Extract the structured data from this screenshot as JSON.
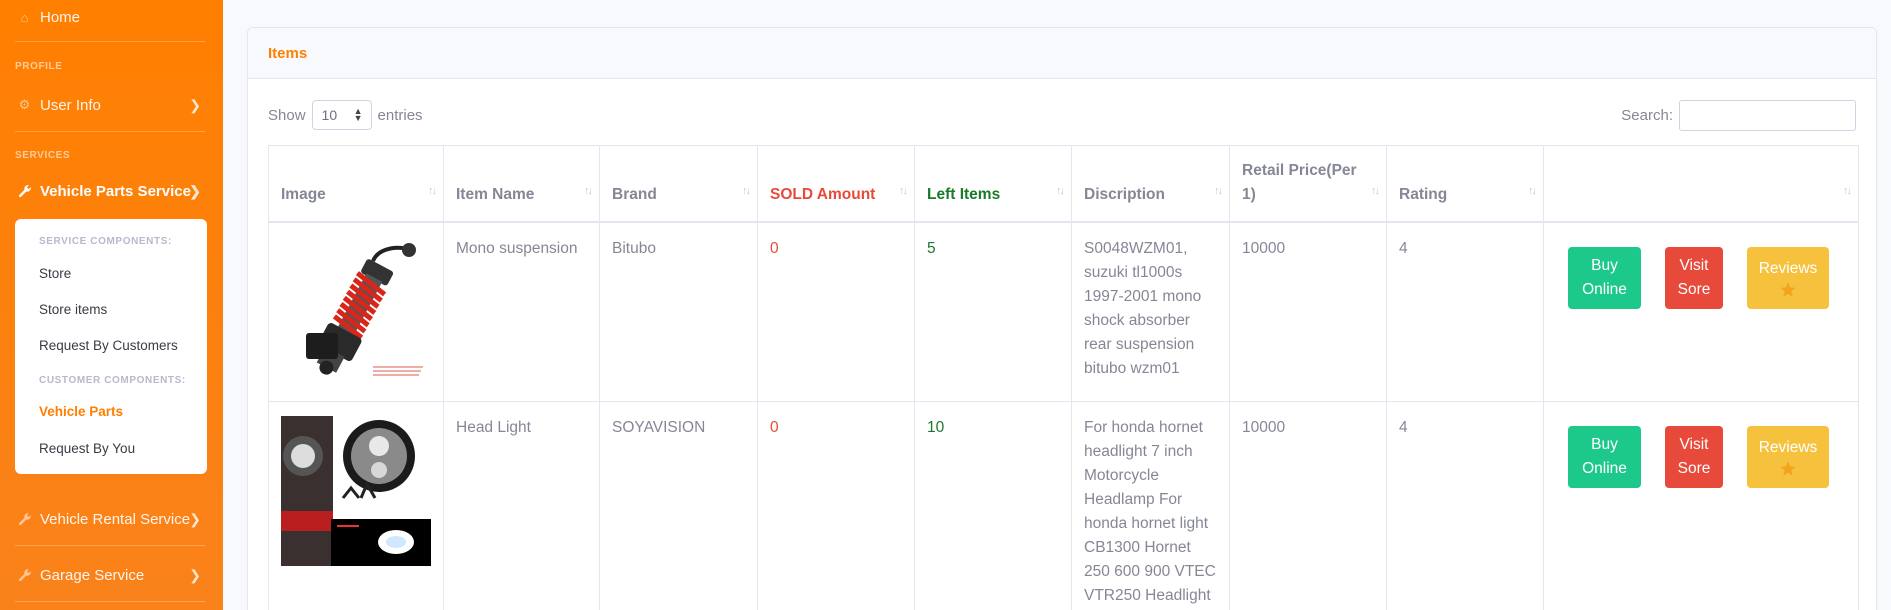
{
  "sidebar": {
    "home": "Home",
    "profile_heading": "PROFILE",
    "user_info": "User Info",
    "services_heading": "SERVICES",
    "vehicle_parts_service": "Vehicle Parts Service",
    "submenu": {
      "service_components_heading": "SERVICE COMPONENTS:",
      "store": "Store",
      "store_items": "Store items",
      "request_by_customers": "Request By Customers",
      "customer_components_heading": "CUSTOMER COMPONENTS:",
      "vehicle_parts": "Vehicle Parts",
      "request_by_you": "Request By You"
    },
    "vehicle_rental_service": "Vehicle Rental Service",
    "garage_service": "Garage Service"
  },
  "card": {
    "title": "Items",
    "show_label": "Show",
    "entries_value": "10",
    "entries_label": "entries",
    "search_label": "Search:"
  },
  "table": {
    "headers": {
      "image": "Image",
      "item_name": "Item Name",
      "brand": "Brand",
      "sold_amount": "SOLD Amount",
      "left_items": "Left Items",
      "description": "Discription",
      "retail_price": "Retail Price(Per 1)",
      "rating": "Rating",
      "actions": ""
    },
    "rows": [
      {
        "item_name": "Mono suspension",
        "brand": "Bitubo",
        "sold": "0",
        "left": "5",
        "description": "S0048WZM01, suzuki tl1000s 1997-2001 mono shock absorber rear suspension bitubo wzm01",
        "price": "10000",
        "rating": "4",
        "buy": "Buy Online",
        "visit": "Visit Sore",
        "reviews": "Reviews"
      },
      {
        "item_name": "Head Light",
        "brand": "SOYAVISION",
        "sold": "0",
        "left": "10",
        "description": "For honda hornet headlight 7 inch Motorcycle Headlamp For honda hornet light CB1300 Hornet 250 600 900 VTEC VTR250 Headlight",
        "price": "10000",
        "rating": "4",
        "buy": "Buy Online",
        "visit": "Visit Sore",
        "reviews": "Reviews"
      }
    ]
  },
  "icons": {
    "home": "home-icon",
    "user_info": "gear-icon",
    "services": "wrench-icon",
    "chevron": "chevron-right-icon",
    "star": "star-icon"
  },
  "colors": {
    "sidebar": "#ff7f00",
    "accent": "#ff7f00",
    "sold": "#e74a3b",
    "left": "#1a7a2a",
    "buy": "#1cc88a",
    "visit": "#e74a3b",
    "reviews": "#f6c23e"
  }
}
